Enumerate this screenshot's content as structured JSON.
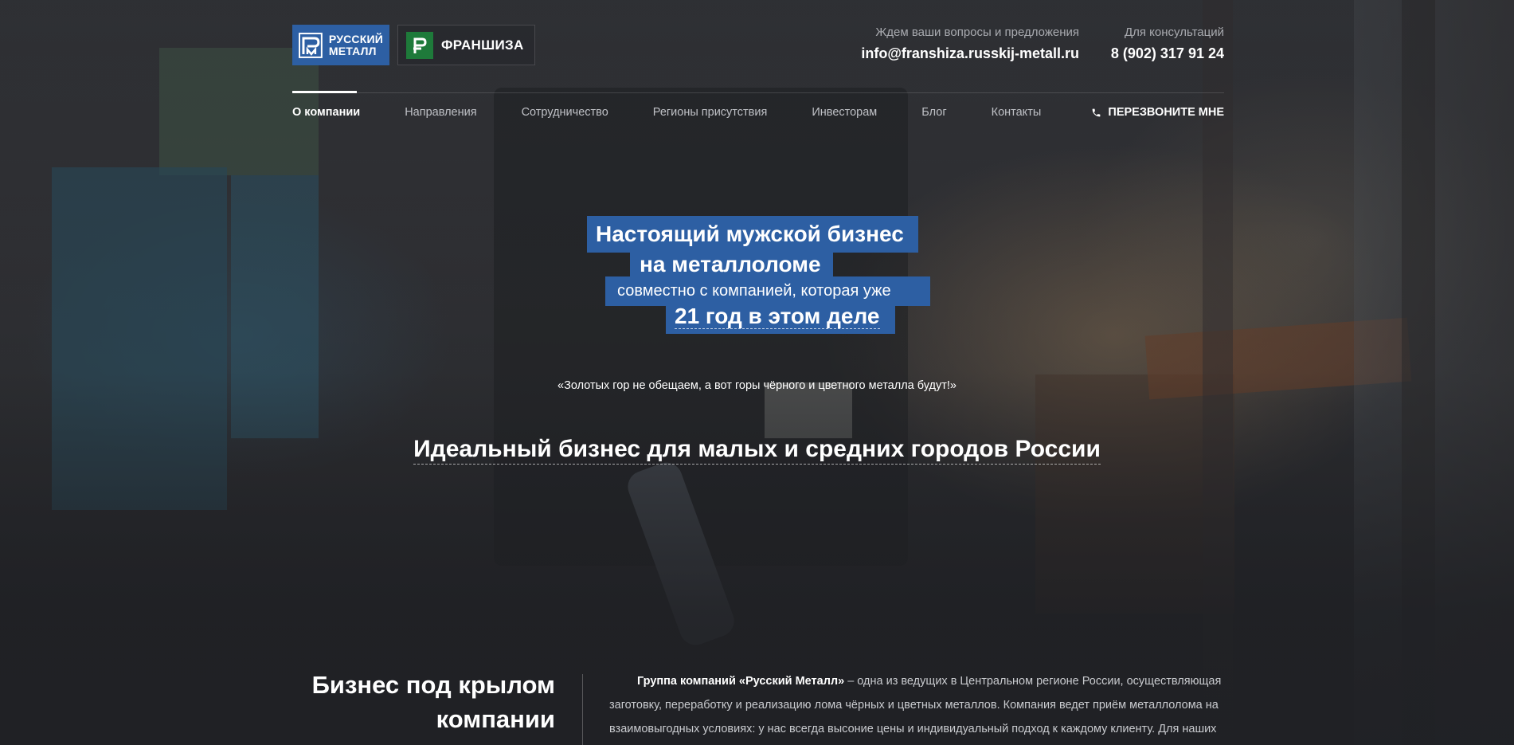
{
  "header": {
    "logo_main_text": "РУССКИЙ МЕТАЛЛ",
    "logo_main_line1": "РУССКИЙ",
    "logo_main_line2": "МЕТАЛЛ",
    "logo_franchise_text": "ФРАНШИЗА",
    "contact_email_caption": "Ждем ваши вопросы и предложения",
    "contact_email": "info@franshiza.russkij-metall.ru",
    "contact_phone_caption": "Для консультаций",
    "contact_phone": "8 (902) 317 91 24"
  },
  "nav": {
    "items": [
      {
        "label": "О компании",
        "active": true
      },
      {
        "label": "Направления",
        "active": false
      },
      {
        "label": "Сотрудничество",
        "active": false
      },
      {
        "label": "Регионы присутствия",
        "active": false
      },
      {
        "label": "Инвесторам",
        "active": false
      },
      {
        "label": "Блог",
        "active": false
      },
      {
        "label": "Контакты",
        "active": false
      }
    ],
    "callback_label": "ПЕРЕЗВОНИТЕ МНЕ",
    "callback_icon": "phone-icon"
  },
  "hero": {
    "headline_line1": "Настоящий мужской бизнес",
    "headline_line2": "на металлоломе",
    "headline_line3": "совместно с компанией, которая уже",
    "headline_line4": "21 год в этом деле",
    "quote": "«Золотых гор не обещаем, а вот горы чёрного и цветного металла будут!»",
    "tagline": "Идеальный бизнес для малых и средних городов России"
  },
  "about": {
    "title": "Бизнес под крылом компании",
    "text_bold": "Группа компаний «Русский Металл»",
    "text_rest": " – одна из ведущих в Центральном регионе России, осуществляющая заготовку, переработку и реализацию лома чёрных и цветных металлов. Компания ведет приём металлолома на взаимовыгодных условиях: у нас всегда высоние цены и индивидуальный подход к каждому клиенту. Для наших"
  },
  "colors": {
    "brand_blue": "#2d5fa3",
    "franchise_green": "#1e7a3a",
    "nav_inactive": "#bfc1c6",
    "caption_gray": "#a9abb0"
  }
}
